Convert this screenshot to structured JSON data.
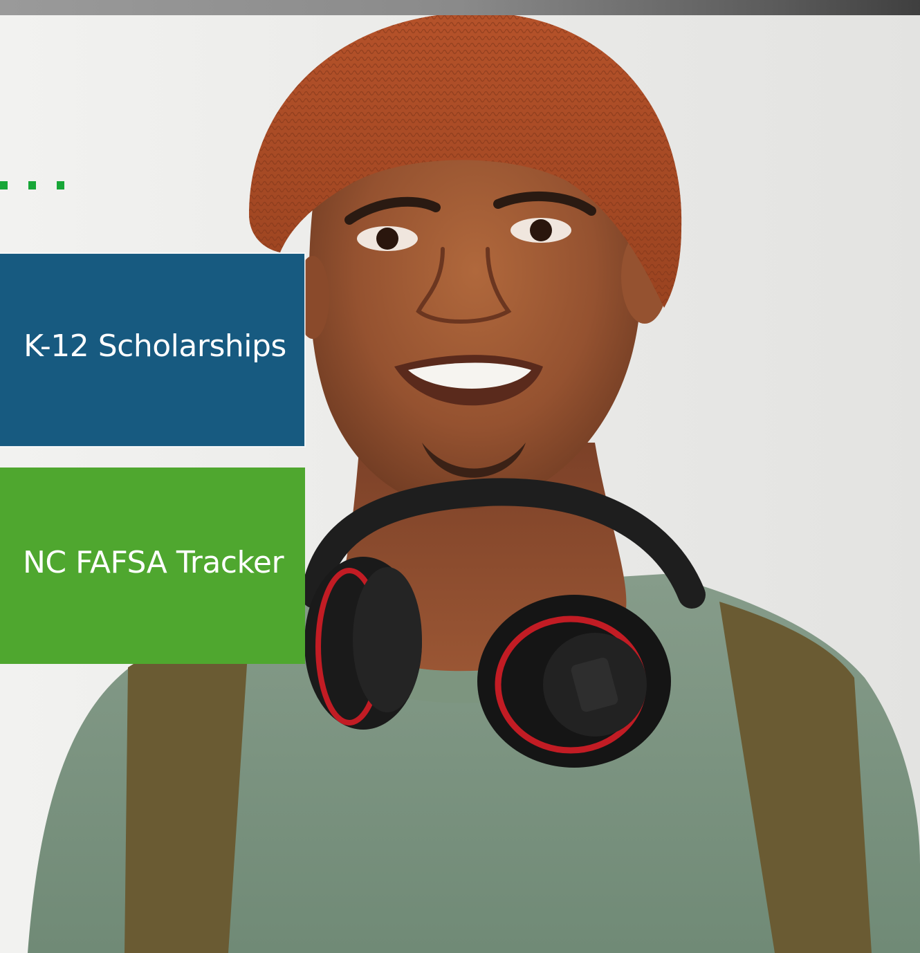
{
  "colors": {
    "brand_blue": "#175a80",
    "brand_green": "#4fa72f",
    "dot_green": "#17a637"
  },
  "photo": {
    "subject": "smiling-student-with-headphones-and-beanie"
  },
  "tiles": [
    {
      "label": "K-12 Scholarships"
    },
    {
      "label": "NC FAFSA Tracker"
    }
  ],
  "decor": {
    "dot_count": 3
  }
}
